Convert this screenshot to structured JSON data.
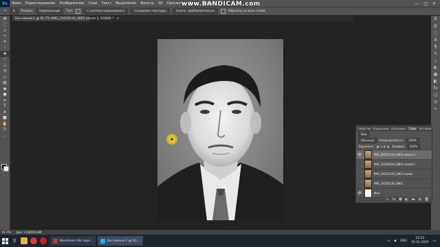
{
  "watermark": "www.BANDICAM.com",
  "menubar": {
    "logo": "Ps",
    "items": [
      "Файл",
      "Редактирование",
      "Изображение",
      "Слои",
      "Текст",
      "Выделение",
      "Фильтр",
      "3D",
      "Просмотр",
      "Окно",
      "Справка"
    ],
    "min": "—",
    "max": "□",
    "close": "✕"
  },
  "options_bar": {
    "brush_size": "0",
    "mode_label": "Режим:",
    "mode_value": "Нормальный",
    "type_label": "Тип:",
    "type_match": "С учетом содержимого",
    "type_texture": "Создание текстуры",
    "type_proximity": "Соотв. приблизительно",
    "sample_all": "Образец со всех слоев"
  },
  "document_tab": {
    "title": "Без имени-1 @ 91,7% (IMG_20250120_0801 копия 3, RGB/8) *",
    "close": "×"
  },
  "layers_panel": {
    "tabs": [
      "Свойства",
      "Коррекция",
      "Операции",
      "Слои",
      "История"
    ],
    "active_tab": "Слои",
    "filter_label": "Вид",
    "blend_mode": "Обычные",
    "opacity_label": "Непрозрачность:",
    "opacity_value": "100%",
    "lock_label": "Закрепить:",
    "fill_label": "Заливка:",
    "fill_value": "100%",
    "layers": [
      {
        "name": "IMG_20250120_0801 копия 3",
        "thumb": "photo",
        "visible": true,
        "selected": true
      },
      {
        "name": "IMG_20250120_0801 копия 2",
        "thumb": "photo",
        "visible": false,
        "selected": false
      },
      {
        "name": "IMG_20250120_0801 копия",
        "thumb": "photo",
        "visible": false,
        "selected": false
      },
      {
        "name": "IMG_20250120_0801",
        "thumb": "photo",
        "visible": false,
        "selected": false
      },
      {
        "name": "Фон",
        "thumb": "white",
        "visible": true,
        "selected": false
      }
    ],
    "bottom_buttons": [
      "link-icon",
      "fx-icon",
      "mask-icon",
      "adjustment-icon",
      "folder-icon",
      "new-layer-icon",
      "trash-icon"
    ]
  },
  "status_bar": {
    "zoom": "91,7%",
    "doc_info": "Док: 1,03M/26,9M"
  },
  "taskbar": {
    "apps": [
      {
        "label": "Bandicam (Не заре...",
        "color": "#c0392b"
      },
      {
        "label": "Без имени-1 @ 91,...",
        "color": "#31a8ff"
      }
    ],
    "tray_lang": "ENG",
    "time": "23:33",
    "date": "20.01.2025"
  }
}
